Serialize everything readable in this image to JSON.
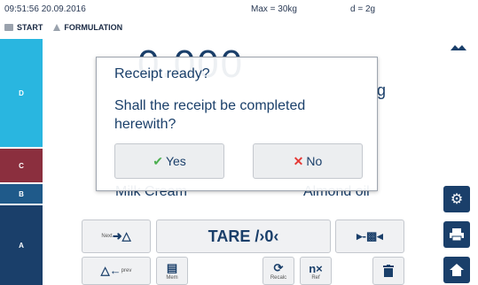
{
  "status": {
    "datetime": "09:51:56 20.09.2016",
    "max": "Max = 30kg",
    "d": "d = 2g"
  },
  "breadcrumb": {
    "start": "START",
    "formulation": "FORMULATION"
  },
  "sidebar": {
    "segments": [
      "D",
      "C",
      "B",
      "A"
    ]
  },
  "background": {
    "value": "0.000",
    "unit": "g",
    "component_left": "Milk Cream",
    "component_right": "Almond oil"
  },
  "dialog": {
    "title": "Receipt ready?",
    "message": "Shall the receipt be completed herewith?",
    "yes_label": "Yes",
    "no_label": "No"
  },
  "controls": {
    "next_label": "Next",
    "tare_label": "TARE /›0‹",
    "prev_label": "prev",
    "mem_label": "Mem",
    "recalc_label": "Recalc",
    "ref_label": "Ref",
    "ref_icon_text": "n×"
  },
  "icons": {
    "gear": "gear-icon",
    "print": "print-icon",
    "home": "home-icon",
    "trash": "trash-icon"
  },
  "colors": {
    "seg_d": "#29b6e0",
    "seg_c": "#8b2f3e",
    "seg_b": "#1f5a8a",
    "seg_a": "#1a3f6a",
    "accent": "#1a3f6a",
    "yes_check": "#4caf50",
    "no_cross": "#e53935"
  }
}
